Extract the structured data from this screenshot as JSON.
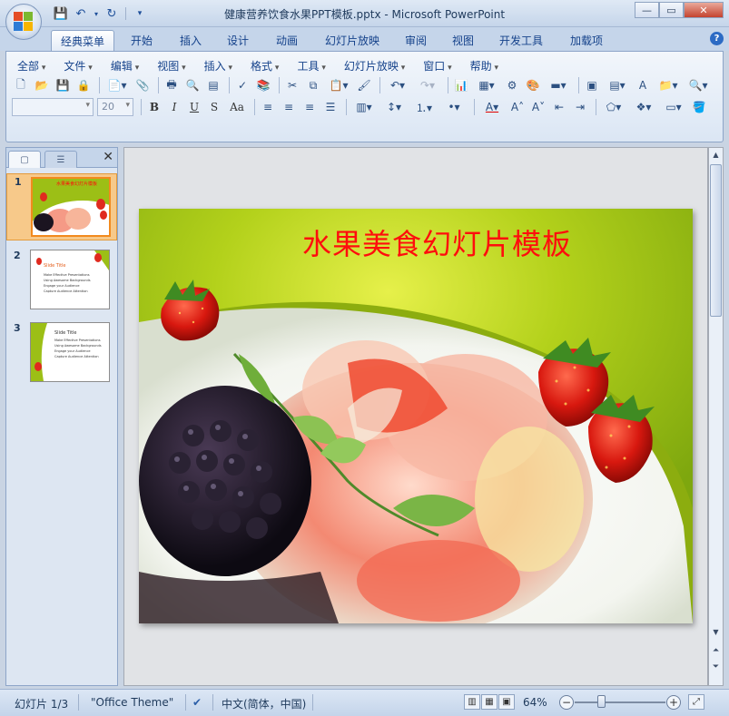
{
  "window": {
    "title": "健康营养饮食水果PPT模板.pptx - Microsoft PowerPoint"
  },
  "ribbon_tabs": [
    "经典菜单",
    "开始",
    "插入",
    "设计",
    "动画",
    "幻灯片放映",
    "审阅",
    "视图",
    "开发工具",
    "加载项"
  ],
  "active_tab": "经典菜单",
  "classic_menu": [
    "全部",
    "文件",
    "编辑",
    "视图",
    "插入",
    "格式",
    "工具",
    "幻灯片放映",
    "窗口",
    "帮助"
  ],
  "font": {
    "name": "",
    "size": "20"
  },
  "format_buttons": [
    "B",
    "I",
    "U",
    "S",
    "Aa"
  ],
  "slides": [
    {
      "number": "1",
      "title": "水果美食幻灯片模板",
      "selected": true
    },
    {
      "number": "2",
      "title": "Slide Title",
      "selected": false
    },
    {
      "number": "3",
      "title": "Slide Title",
      "selected": false
    }
  ],
  "thumbnail_bullets": [
    "Make Effective Presentations",
    "Using Awesome Backgrounds",
    "Engage your Audience",
    "Capture Audience Attention"
  ],
  "main_slide": {
    "title": "水果美食幻灯片模板"
  },
  "statusbar": {
    "slide_counter": "幻灯片 1/3",
    "theme": "\"Office Theme\"",
    "language": "中文(简体，中国)",
    "zoom": "64%"
  },
  "colors": {
    "slide_title": "#ff0d0d",
    "slide_background": "#9cbf16",
    "ribbon_text": "#15428b",
    "selected_thumb": "#f28a1e"
  }
}
